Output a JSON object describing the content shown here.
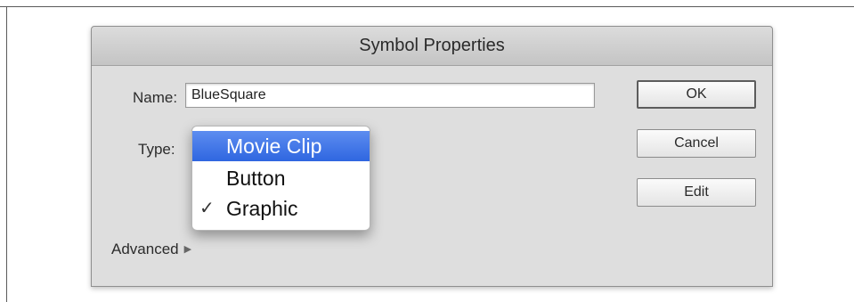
{
  "dialog": {
    "title": "Symbol Properties",
    "name_label": "Name:",
    "name_value": "BlueSquare",
    "type_label": "Type:",
    "advanced_label": "Advanced",
    "arrow_icon": "disclosure-triangle-right-icon"
  },
  "type_menu": {
    "items": [
      {
        "label": "Movie Clip",
        "highlighted": true,
        "checked": false
      },
      {
        "label": "Button",
        "highlighted": false,
        "checked": false
      },
      {
        "label": "Graphic",
        "highlighted": false,
        "checked": true
      }
    ],
    "check_glyph": "✓",
    "highlight_color": "#3d74e6"
  },
  "buttons": {
    "ok": "OK",
    "cancel": "Cancel",
    "edit": "Edit"
  }
}
